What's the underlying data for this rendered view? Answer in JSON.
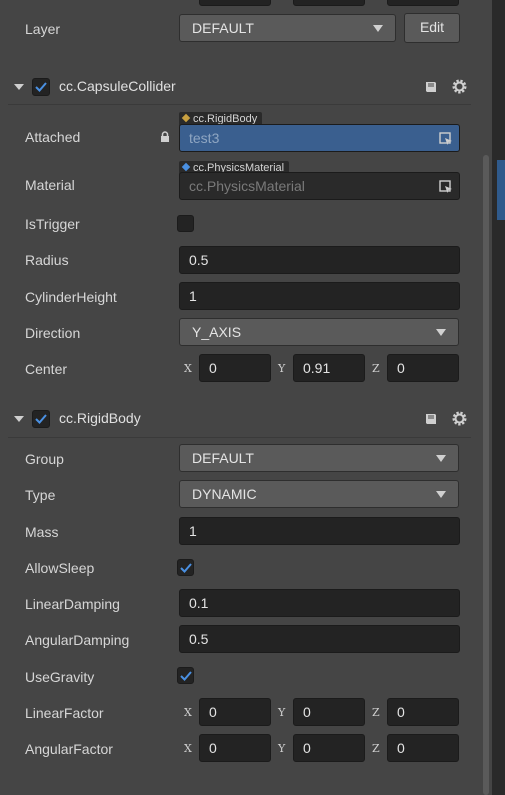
{
  "layer": {
    "label": "Layer",
    "value": "DEFAULT",
    "edit_label": "Edit"
  },
  "capsule": {
    "title": "cc.CapsuleCollider",
    "attached": {
      "label": "Attached",
      "tag": "cc.RigidBody",
      "value": "test3"
    },
    "material": {
      "label": "Material",
      "tag": "cc.PhysicsMaterial",
      "placeholder": "cc.PhysicsMaterial"
    },
    "is_trigger": {
      "label": "IsTrigger",
      "checked": false
    },
    "radius": {
      "label": "Radius",
      "value": "0.5"
    },
    "cylinder_height": {
      "label": "CylinderHeight",
      "value": "1"
    },
    "direction": {
      "label": "Direction",
      "value": "Y_AXIS"
    },
    "center": {
      "label": "Center",
      "x": "0",
      "y": "0.91",
      "z": "0"
    }
  },
  "rigidbody": {
    "title": "cc.RigidBody",
    "group": {
      "label": "Group",
      "value": "DEFAULT"
    },
    "type": {
      "label": "Type",
      "value": "DYNAMIC"
    },
    "mass": {
      "label": "Mass",
      "value": "1"
    },
    "allow_sleep": {
      "label": "AllowSleep",
      "checked": true
    },
    "linear_damping": {
      "label": "LinearDamping",
      "value": "0.1"
    },
    "angular_damping": {
      "label": "AngularDamping",
      "value": "0.5"
    },
    "use_gravity": {
      "label": "UseGravity",
      "checked": true
    },
    "linear_factor": {
      "label": "LinearFactor",
      "x": "0",
      "y": "0",
      "z": "0"
    },
    "angular_factor": {
      "label": "AngularFactor",
      "x": "0",
      "y": "0",
      "z": "0"
    }
  },
  "axes": {
    "x": "X",
    "y": "Y",
    "z": "Z"
  },
  "colors": {
    "accent": "#4a90e2",
    "attached_bg": "#3a5f8f",
    "tag_rigidbody_dot": "#c8a040",
    "tag_material_dot": "#4a90e2"
  }
}
